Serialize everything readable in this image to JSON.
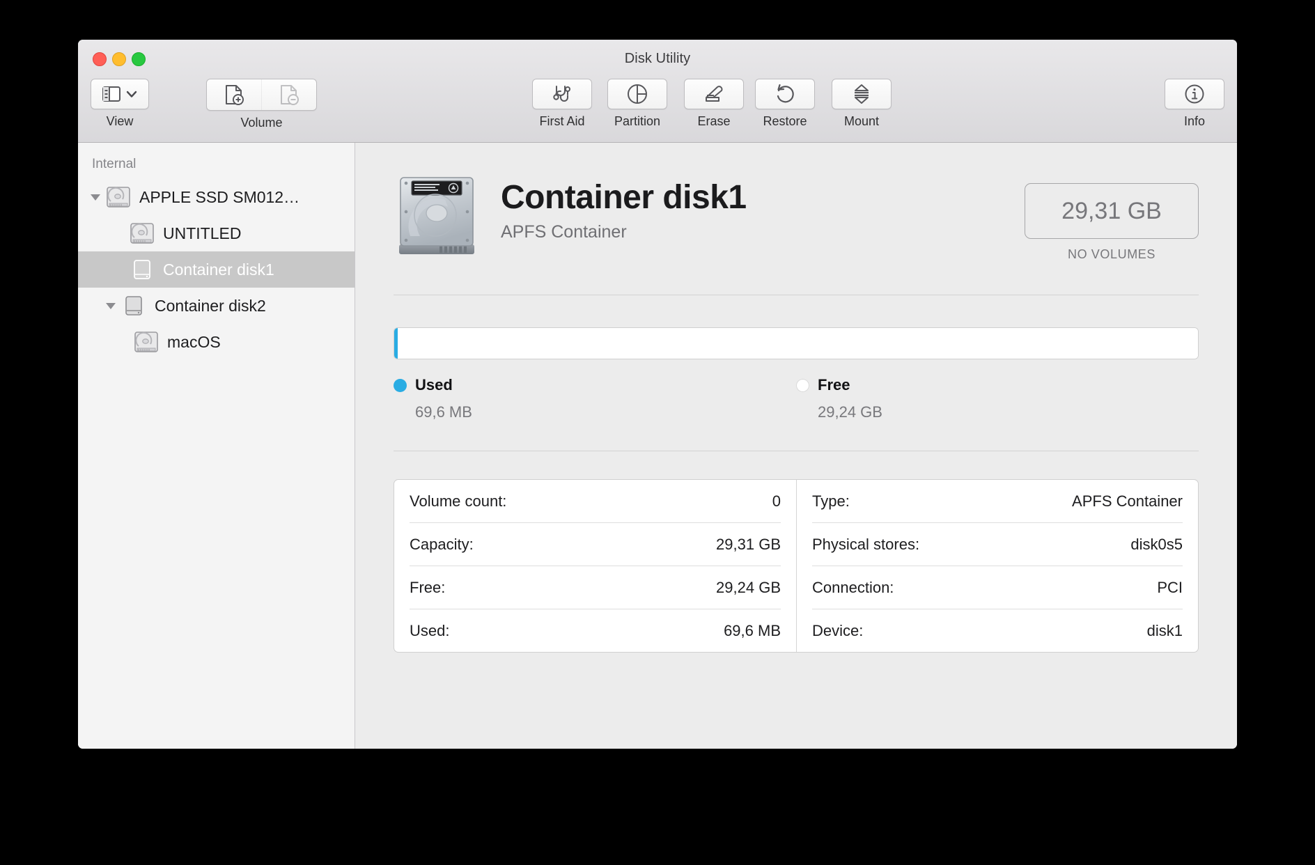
{
  "window": {
    "title": "Disk Utility",
    "traffic_lights": [
      "close",
      "minimize",
      "maximize"
    ]
  },
  "toolbar": {
    "groups": [
      {
        "name": "view",
        "label": "View",
        "icon": "sidebar-view-icon"
      },
      {
        "name": "volume",
        "label": "Volume",
        "icon": "volume-add-icon",
        "icon2": "volume-remove-icon"
      },
      {
        "name": "firstaid",
        "label": "First Aid",
        "icon": "stethoscope-icon"
      },
      {
        "name": "partition",
        "label": "Partition",
        "icon": "pie-chart-icon"
      },
      {
        "name": "erase",
        "label": "Erase",
        "icon": "erase-icon"
      },
      {
        "name": "restore",
        "label": "Restore",
        "icon": "restore-undo-icon"
      },
      {
        "name": "mount",
        "label": "Mount",
        "icon": "eject-mount-icon"
      },
      {
        "name": "info",
        "label": "Info",
        "icon": "info-circle-icon"
      }
    ]
  },
  "sidebar": {
    "header": "Internal",
    "items": [
      {
        "label": "APPLE SSD SM012…",
        "icon": "internal-disk-icon",
        "indent": 0,
        "twisty": "down",
        "selected": false
      },
      {
        "label": "UNTITLED",
        "icon": "internal-disk-icon",
        "indent": 1,
        "twisty": "none",
        "selected": false
      },
      {
        "label": "Container disk1",
        "icon": "container-disk-icon",
        "indent": 1,
        "twisty": "none",
        "selected": true
      },
      {
        "label": "Container disk2",
        "icon": "container-disk-icon",
        "indent": 0,
        "twisty": "down",
        "selected": false
      },
      {
        "label": "macOS",
        "icon": "internal-disk-icon",
        "indent": 2,
        "twisty": "none",
        "selected": false
      }
    ]
  },
  "main": {
    "disk_name": "Container disk1",
    "disk_subtitle": "APFS Container",
    "capacity_value": "29,31 GB",
    "capacity_caption": "NO VOLUMES",
    "usage": {
      "used_label": "Used",
      "used_value": "69,6 MB",
      "used_color": "#29ace3",
      "used_percent": 0.24,
      "free_label": "Free",
      "free_value": "29,24 GB",
      "free_color": "#ffffff",
      "free_percent": 99.76
    },
    "details_left": [
      {
        "key": "Volume count:",
        "value": "0"
      },
      {
        "key": "Capacity:",
        "value": "29,31 GB"
      },
      {
        "key": "Free:",
        "value": "29,24 GB"
      },
      {
        "key": "Used:",
        "value": "69,6 MB"
      }
    ],
    "details_right": [
      {
        "key": "Type:",
        "value": "APFS Container"
      },
      {
        "key": "Physical stores:",
        "value": "disk0s5"
      },
      {
        "key": "Connection:",
        "value": "PCI"
      },
      {
        "key": "Device:",
        "value": "disk1"
      }
    ]
  }
}
